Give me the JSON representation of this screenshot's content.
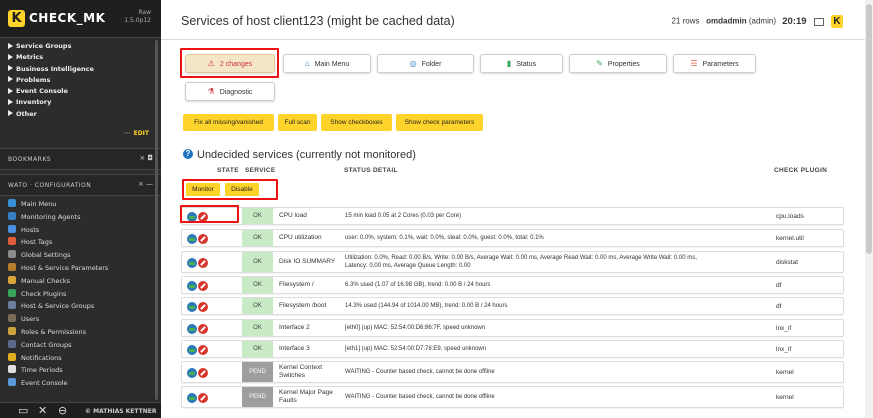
{
  "app": {
    "logo_letter": "K",
    "logo_text": "CHECK_MK",
    "version_line1": "Raw",
    "version_line2": "1.5.0p12"
  },
  "sidebar": {
    "menu": [
      {
        "label": "Service Groups"
      },
      {
        "label": "Metrics"
      },
      {
        "label": "Business Intelligence"
      },
      {
        "label": "Problems"
      },
      {
        "label": "Event Console"
      },
      {
        "label": "Inventory"
      },
      {
        "label": "Other"
      }
    ],
    "edit_dots": "···",
    "edit_label": "EDIT",
    "bookmarks_title": "BOOKMARKS",
    "bookmarks_ctrl": "× ◘",
    "wato_title": "WATO · CONFIGURATION",
    "wato_ctrl": "× —",
    "wato_items": [
      {
        "label": "Main Menu",
        "color": "#3a8fd9"
      },
      {
        "label": "Monitoring Agents",
        "color": "#3a7fc9"
      },
      {
        "label": "Hosts",
        "color": "#4a90e2"
      },
      {
        "label": "Host Tags",
        "color": "#e05c3a"
      },
      {
        "label": "Global Settings",
        "color": "#8a8a8a"
      },
      {
        "label": "Host & Service Parameters",
        "color": "#b57d2b"
      },
      {
        "label": "Manual Checks",
        "color": "#d9a43a"
      },
      {
        "label": "Check Plugins",
        "color": "#3aa35c"
      },
      {
        "label": "Host & Service Groups",
        "color": "#6c7fa0"
      },
      {
        "label": "Users",
        "color": "#7a6a5a"
      },
      {
        "label": "Roles & Permissions",
        "color": "#c9a23a"
      },
      {
        "label": "Contact Groups",
        "color": "#5a6a8a"
      },
      {
        "label": "Notifications",
        "color": "#e0b020"
      },
      {
        "label": "Time Periods",
        "color": "#e0e0e0"
      },
      {
        "label": "Event Console",
        "color": "#5a9ad9"
      }
    ],
    "footer_brand": "© MATHIAS KETTNER"
  },
  "header": {
    "title": "Services of host client123 (might be cached data)",
    "rows_text": "21 rows",
    "user": "omdadmin",
    "role": "(admin)",
    "time": "20:19",
    "k_logo": "K"
  },
  "toolbar": {
    "changes_label": "2 changes",
    "main_menu_label": "Main Menu",
    "folder_label": "Folder",
    "status_label": "Status",
    "properties_label": "Properties",
    "parameters_label": "Parameters",
    "diagnostic_label": "Diagnostic"
  },
  "actions": {
    "fix_all": "Fix all missing/vanished",
    "full_scan": "Full scan",
    "show_checkboxes": "Show checkboxes",
    "show_check_params": "Show check parameters"
  },
  "section": {
    "title": "Undecided services (currently not monitored)",
    "columns": {
      "state": "STATE",
      "service": "SERVICE",
      "status_detail": "STATUS DETAIL",
      "check_plugin": "CHECK PLUGIN"
    },
    "monitor_label": "Monitor",
    "disable_label": "Disable"
  },
  "rows": [
    {
      "state": "OK",
      "service": "CPU load",
      "detail": "15 min load 0.05 at 2 Cores (0.03 per Core)",
      "plugin": "cpu.loads"
    },
    {
      "state": "OK",
      "service": "CPU utilization",
      "detail": "user: 0.0%, system: 0.1%, wait: 0.0%, steal: 0.0%, guest: 0.0%, total: 0.1%",
      "plugin": "kernel.util"
    },
    {
      "state": "OK",
      "service": "Disk IO SUMMARY",
      "detail": "Utilization: 0.0%, Read: 0.00 B/s, Write: 0.00 B/s, Average Wait: 0.00 ms, Average Read Wait: 0.00 ms, Average Write Wait: 0.00 ms,\nLatency: 0.00 ms, Average Queue Length: 0.00",
      "plugin": "diskstat"
    },
    {
      "state": "OK",
      "service": "Filesystem /",
      "detail": "6.3% used (1.07 of 16.98 GB), trend: 0.00 B / 24 hours",
      "plugin": "df"
    },
    {
      "state": "OK",
      "service": "Filesystem /boot",
      "detail": "14.3% used (144.94 of 1014.00 MB), trend: 0.00 B / 24 hours",
      "plugin": "df"
    },
    {
      "state": "OK",
      "service": "Interface 2",
      "detail": "[eth0] (up) MAC: 52:54:00:D6:86:7F, speed unknown",
      "plugin": "lnx_if"
    },
    {
      "state": "OK",
      "service": "Interface 3",
      "detail": "[eth1] (up) MAC: 52:54:00:D7:78:E9, speed unknown",
      "plugin": "lnx_if"
    },
    {
      "state": "PEND",
      "service": "Kernel Context Switches",
      "detail": "WAITING - Counter based check, cannot be done offline",
      "plugin": "kernel"
    },
    {
      "state": "PEND",
      "service": "Kernel Major Page Faults",
      "detail": "WAITING - Counter based check, cannot be done offline",
      "plugin": "kernel"
    }
  ]
}
